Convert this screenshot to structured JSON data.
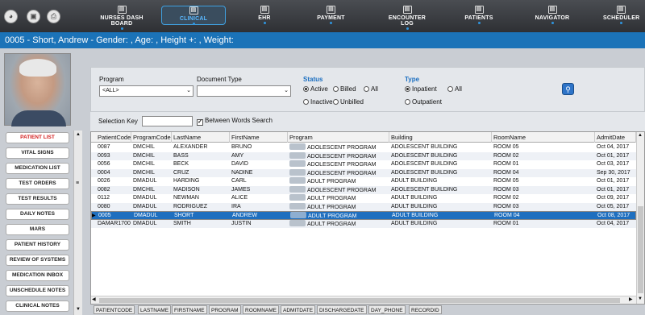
{
  "topbar": {
    "left_icons": [
      "dashboard-gauge-icon",
      "stop-icon",
      "print-icon"
    ],
    "nav": [
      {
        "label": "NURSES DASH BOARD",
        "icon": "monitor-icon"
      },
      {
        "label": "CLINICAL",
        "icon": "clipboard-icon",
        "active": true
      },
      {
        "label": "EHR",
        "icon": "chart-icon"
      },
      {
        "label": "PAYMENT",
        "icon": "payment-icon"
      },
      {
        "label": "ENCOUNTER LOG",
        "icon": "log-icon"
      },
      {
        "label": "PATIENTS",
        "icon": "patients-icon"
      },
      {
        "label": "NAVIGATOR",
        "icon": "navigator-icon"
      },
      {
        "label": "SCHEDULER",
        "icon": "calendar-icon"
      }
    ]
  },
  "patient_bar": {
    "text": "0005 - Short, Andrew - Gender: , Age: , Height +: , Weight:"
  },
  "sidebar": {
    "items": [
      {
        "label": "PATIENT LIST",
        "highlight": true
      },
      {
        "label": "VITAL SIGNS"
      },
      {
        "label": "MEDICATION LIST"
      },
      {
        "label": "TEST ORDERS"
      },
      {
        "label": "TEST RESULTS"
      },
      {
        "label": "DAILY NOTES"
      },
      {
        "label": "MARS"
      },
      {
        "label": "PATIENT HISTORY"
      },
      {
        "label": "REVIEW OF SYSTEMS"
      },
      {
        "label": "MEDICATION INBOX"
      },
      {
        "label": "UNSCHEDULE NOTES"
      },
      {
        "label": "CLINICAL NOTES"
      }
    ]
  },
  "filters": {
    "program_label": "Program",
    "program_value": "<ALL>",
    "doctype_label": "Document Type",
    "doctype_value": "",
    "status_label": "Status",
    "status_options": [
      "Active",
      "Billed",
      "All",
      "Inactive",
      "Unbilled"
    ],
    "status_selected": "Active",
    "type_label": "Type",
    "type_options": [
      "Inpatient",
      "All",
      "Outpatient"
    ],
    "type_selected": "Inpatient"
  },
  "selection": {
    "key_label": "Selection Key",
    "key_value": "",
    "between_words_label": "Between Words Search",
    "between_words_checked": true
  },
  "grid": {
    "columns": [
      "PatientCode",
      "ProgramCode",
      "LastName",
      "FirstName",
      "Program",
      "Building",
      "RoomName",
      "AdmitDate"
    ],
    "rows": [
      [
        "0087",
        "DMCHIL",
        "ALEXANDER",
        "BRUNO",
        "ADOLESCENT PROGRAM",
        "ADOLESCENT BUILDING",
        "ROOM 05",
        "Oct 04, 2017"
      ],
      [
        "0093",
        "DMCHIL",
        "BASS",
        "AMY",
        "ADOLESCENT PROGRAM",
        "ADOLESCENT BUILDING",
        "ROOM 02",
        "Oct 01, 2017"
      ],
      [
        "0056",
        "DMCHIL",
        "BECK",
        "DAVID",
        "ADOLESCENT PROGRAM",
        "ADOLESCENT BUILDING",
        "ROOM 01",
        "Oct 03, 2017"
      ],
      [
        "0004",
        "DMCHIL",
        "CRUZ",
        "NADINE",
        "ADOLESCENT PROGRAM",
        "ADOLESCENT BUILDING",
        "ROOM 04",
        "Sep 30, 2017"
      ],
      [
        "0026",
        "DMADUL",
        "HARDING",
        "CARL",
        "ADULT PROGRAM",
        "ADULT BUILDING",
        "ROOM 05",
        "Oct 01, 2017"
      ],
      [
        "0082",
        "DMCHIL",
        "MADISON",
        "JAMES",
        "ADOLESCENT PROGRAM",
        "ADOLESCENT BUILDING",
        "ROOM 03",
        "Oct 01, 2017"
      ],
      [
        "0112",
        "DMADUL",
        "NEWMAN",
        "ALICE",
        "ADULT PROGRAM",
        "ADULT BUILDING",
        "ROOM 02",
        "Oct 09, 2017"
      ],
      [
        "0080",
        "DMADUL",
        "RODRIGUEZ",
        "IRA",
        "ADULT PROGRAM",
        "ADULT BUILDING",
        "ROOM 03",
        "Oct 05, 2017"
      ],
      [
        "0005",
        "DMADUL",
        "SHORT",
        "ANDREW",
        "ADULT PROGRAM",
        "ADULT BUILDING",
        "ROOM 04",
        "Oct 08, 2017"
      ],
      [
        "DAMAR1700",
        "DMADUL",
        "SMITH",
        "JUSTIN",
        "ADULT PROGRAM",
        "ADULT BUILDING",
        "ROOM 01",
        "Oct 04, 2017"
      ]
    ],
    "selected_index": 8
  },
  "bottom_tabs": [
    "PATIENTCODE",
    "LASTNAME",
    "FIRSTNAME",
    "PROGRAM",
    "ROOMNAME",
    "ADMITDATE",
    "DISCHARGEDATE",
    "DAY_PHONE",
    "RECORDID"
  ]
}
